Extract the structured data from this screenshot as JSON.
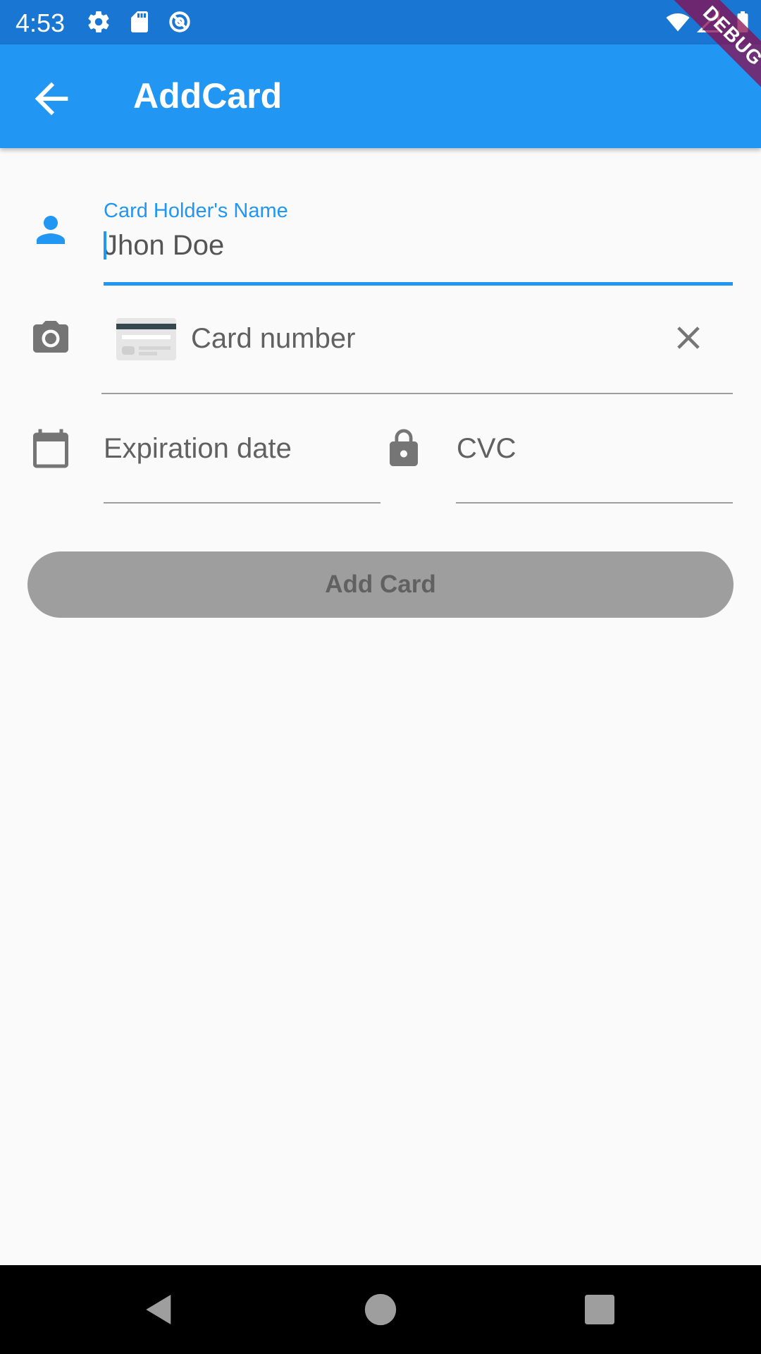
{
  "status_bar": {
    "time": "4:53",
    "icons": [
      "settings-icon",
      "sd-card-icon",
      "data-saver-icon",
      "wifi-icon",
      "signal-icon",
      "battery-icon"
    ]
  },
  "app_bar": {
    "title": "AddCard",
    "back_icon": "arrow-back-icon"
  },
  "debug_banner": "DEBUG",
  "form": {
    "card_holder": {
      "label": "Card Holder's Name",
      "value": "Jhon Doe",
      "icon": "person-icon"
    },
    "card_number": {
      "placeholder": "Card number",
      "icon": "camera-icon",
      "brand_icon": "credit-card-icon",
      "clear_icon": "close-icon"
    },
    "expiration": {
      "placeholder": "Expiration date",
      "icon": "calendar-icon"
    },
    "cvc": {
      "placeholder": "CVC",
      "icon": "lock-icon"
    }
  },
  "add_card_button": "Add Card",
  "colors": {
    "primary": "#2196f3",
    "status_bar": "#1976d2",
    "disabled_button": "#9e9e9e",
    "icon_grey": "#757575"
  }
}
